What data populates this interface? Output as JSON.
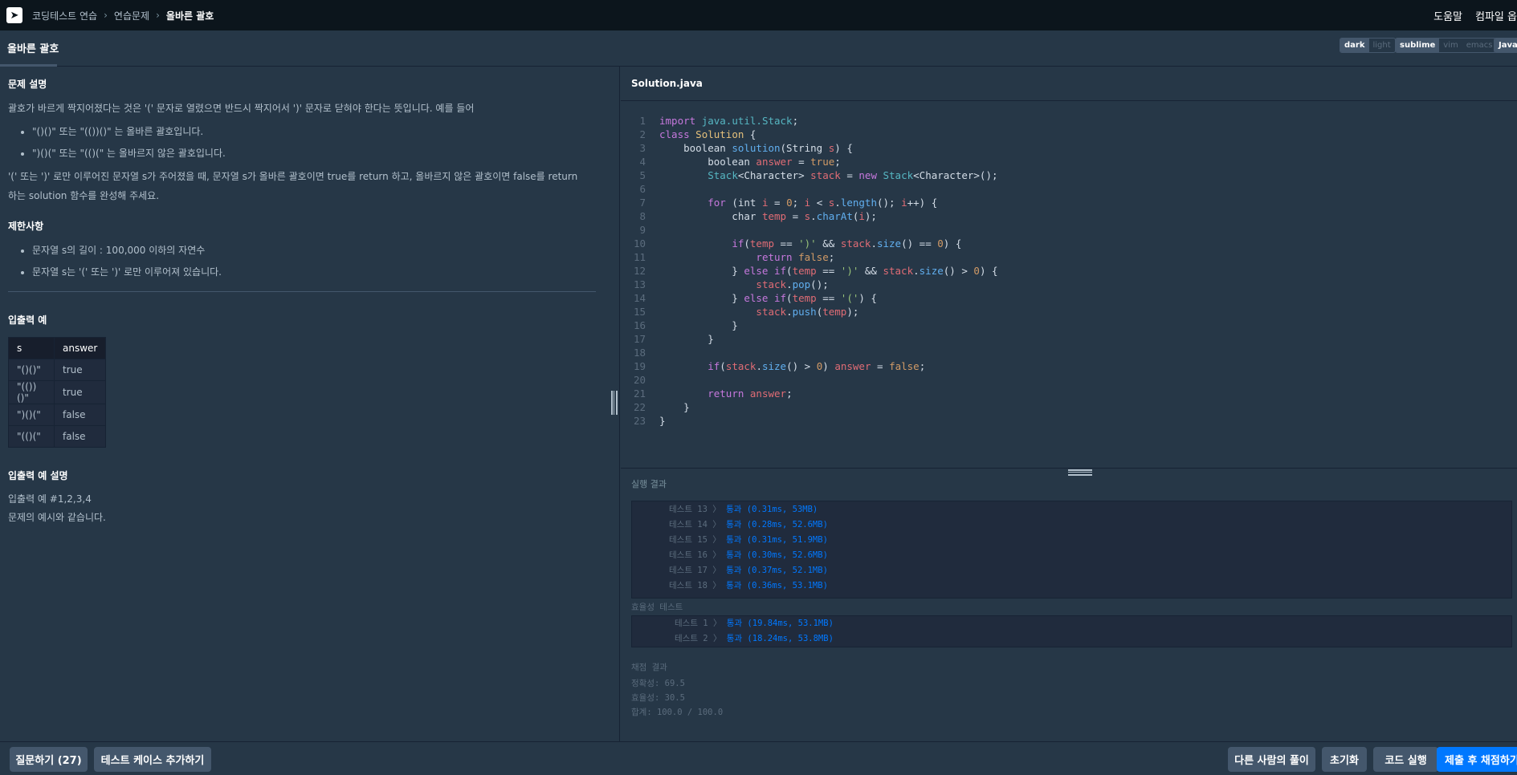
{
  "nav": {
    "breadcrumbs": [
      "코딩테스트 연습",
      "연습문제",
      "올바른 괄호"
    ],
    "links": [
      "도움말",
      "컴파일 옵"
    ]
  },
  "header": {
    "title": "올바른 괄호",
    "theme_options": [
      "dark",
      "light"
    ],
    "theme_selected": "dark",
    "keymap_options": [
      "sublime",
      "vim",
      "emacs"
    ],
    "keymap_selected": "sublime",
    "language": "Java"
  },
  "problem": {
    "section_title": "문제 설명",
    "intro": "괄호가 바르게 짝지어졌다는 것은 '(' 문자로 열렸으면 반드시 짝지어서 ')' 문자로 닫혀야 한다는 뜻입니다. 예를 들어",
    "examples": [
      "\"()()\" 또는 \"(())()\" 는 올바른 괄호입니다.",
      "\")()(\" 또는 \"(()(\" 는 올바르지 않은 괄호입니다."
    ],
    "task_line1": "'(' 또는 ')' 로만 이루어진 문자열 s가 주어졌을 때, 문자열 s가 올바른 괄호이면 true를 return 하고, 올바르지 않은 괄호이면 false를 return",
    "task_line2": "하는 solution 함수를 완성해 주세요.",
    "constraints_title": "제한사항",
    "constraints": [
      "문자열 s의 길이 : 100,000 이하의 자연수",
      "문자열 s는 '(' 또는 ')' 로만 이루어져 있습니다."
    ],
    "io_title": "입출력 예",
    "io_table": {
      "headers": [
        "s",
        "answer"
      ],
      "rows": [
        [
          "\"()()\"",
          "true"
        ],
        [
          "\"(())()\"",
          "true"
        ],
        [
          "\")()(\"",
          "false"
        ],
        [
          "\"(()(\"",
          "false"
        ]
      ]
    },
    "io_desc_title": "입출력 예 설명",
    "io_desc_lines": [
      "입출력 예 #1,2,3,4",
      "문제의 예시와 같습니다."
    ]
  },
  "editor": {
    "filename": "Solution.java",
    "line_numbers": [
      "1",
      "2",
      "3",
      "4",
      "5",
      "6",
      "7",
      "8",
      "9",
      "10",
      "11",
      "12",
      "13",
      "14",
      "15",
      "16",
      "17",
      "18",
      "19",
      "20",
      "21",
      "22",
      "23"
    ],
    "code": [
      "import java.util.Stack;",
      "class Solution {",
      "    boolean solution(String s) {",
      "        boolean answer = true;",
      "        Stack<Character> stack = new Stack<Character>();",
      "",
      "        for (int i = 0; i < s.length(); i++) {",
      "            char temp = s.charAt(i);",
      "",
      "            if(temp == ')' && stack.size() == 0) {",
      "                return false;",
      "            } else if(temp == ')' && stack.size() > 0) {",
      "                stack.pop();",
      "            } else if(temp == '(') {",
      "                stack.push(temp);",
      "            }",
      "        }",
      "",
      "        if(stack.size() > 0) answer = false;",
      "",
      "        return answer;",
      "    }",
      "}"
    ]
  },
  "result": {
    "label": "실행 결과",
    "accuracy_tests": [
      {
        "label": "테스트 13 〉",
        "value": "통과 (0.31ms, 53MB)"
      },
      {
        "label": "테스트 14 〉",
        "value": "통과 (0.28ms, 52.6MB)"
      },
      {
        "label": "테스트 15 〉",
        "value": "통과 (0.31ms, 51.9MB)"
      },
      {
        "label": "테스트 16 〉",
        "value": "통과 (0.30ms, 52.6MB)"
      },
      {
        "label": "테스트 17 〉",
        "value": "통과 (0.37ms, 52.1MB)"
      },
      {
        "label": "테스트 18 〉",
        "value": "통과 (0.36ms, 53.1MB)"
      }
    ],
    "efficiency_label": "효율성  테스트",
    "efficiency_tests": [
      {
        "label": "테스트 1 〉",
        "value": "통과 (19.84ms, 53.1MB)"
      },
      {
        "label": "테스트 2 〉",
        "value": "통과 (18.24ms, 53.8MB)"
      }
    ],
    "score_title": "채점 결과",
    "score_lines": [
      "정확성: 69.5",
      "효율성: 30.5",
      "합계: 100.0 / 100.0"
    ]
  },
  "bottom": {
    "ask": "질문하기 (27)",
    "add_test": "테스트 케이스 추가하기",
    "others": "다른 사람의 풀이",
    "reset": "초기화",
    "run": "코드 실행",
    "submit": "제출 후 채점하기"
  },
  "colors": {
    "accent": "#0078ff",
    "background": "#263747",
    "nav": "#0c151c"
  }
}
